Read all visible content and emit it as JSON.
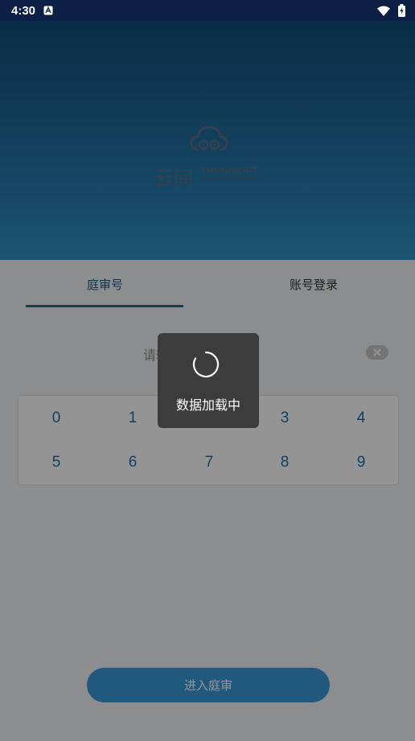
{
  "status_bar": {
    "time": "4:30",
    "icons": [
      "notification-a-icon",
      "wifi-icon",
      "battery-charging-icon"
    ]
  },
  "header": {
    "logo": {
      "cn": "云间",
      "en": "THUNISOFT"
    }
  },
  "tabs": [
    {
      "label": "庭审号"
    },
    {
      "label": "账号登录"
    }
  ],
  "code_input": {
    "placeholder": "请输入庭审号"
  },
  "keypad": {
    "keys": [
      "0",
      "1",
      "2",
      "3",
      "4",
      "5",
      "6",
      "7",
      "8",
      "9"
    ]
  },
  "submit": {
    "label": "进入庭审"
  },
  "loading": {
    "text": "数据加载中"
  },
  "colors": {
    "status_bar": "#0c1f45",
    "header_top": "#144d79",
    "header_bottom": "#2e92c7",
    "accent": "#1e6fa8",
    "button": "#3a9ad9",
    "dialog": "#3c3c3c"
  }
}
